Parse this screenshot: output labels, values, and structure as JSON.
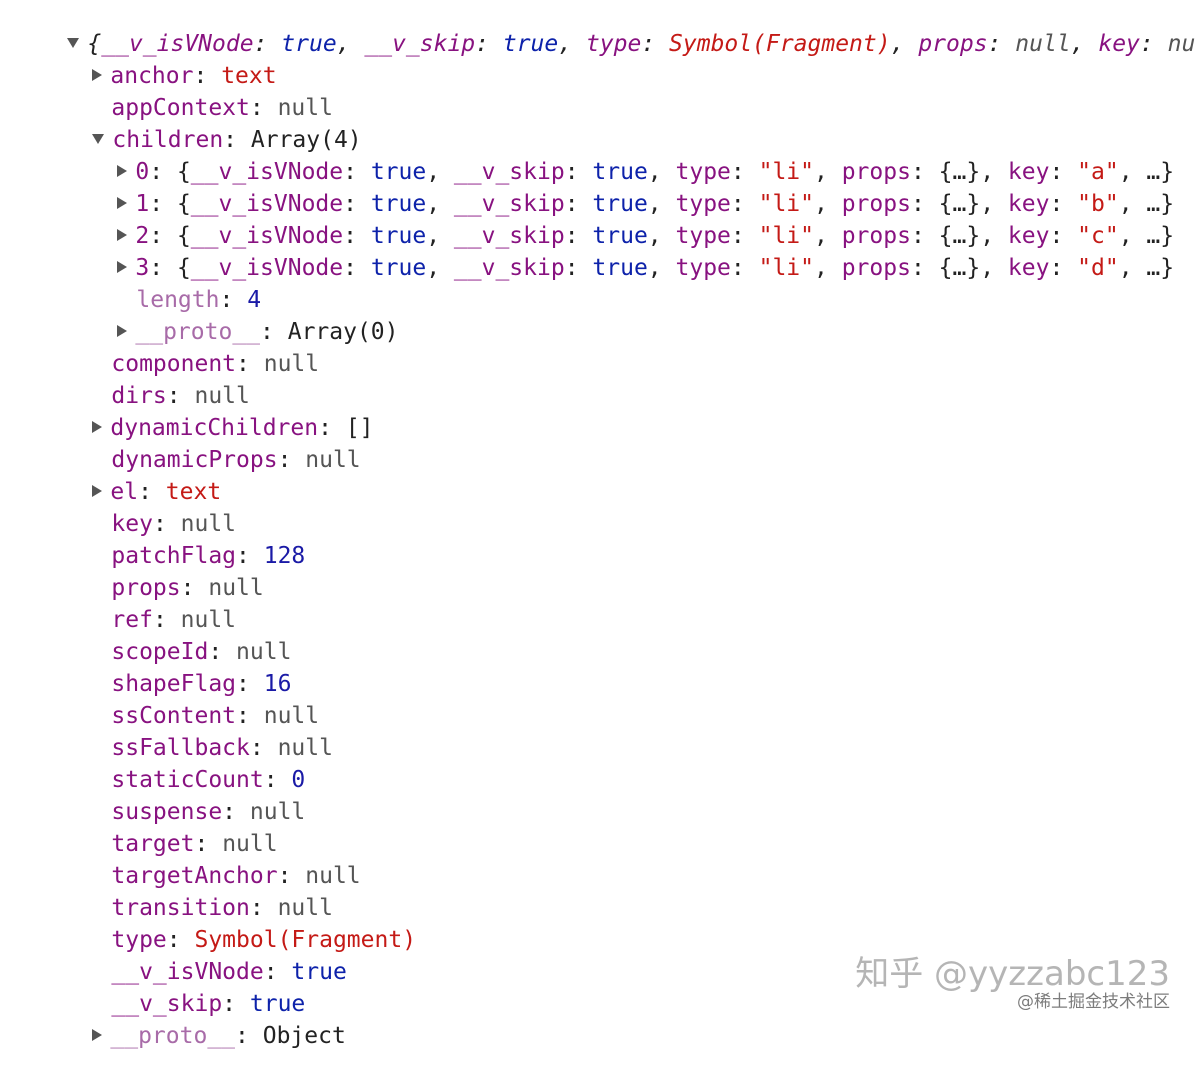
{
  "header": {
    "open": "{",
    "k1": "__v_isVNode",
    "v1": "true",
    "k2": "__v_skip",
    "v2": "true",
    "k3": "type",
    "v3": "Symbol(Fragment)",
    "k4": "props",
    "v4": "null",
    "k5": "key",
    "v5": "nul"
  },
  "props": {
    "anchor": {
      "key": "anchor",
      "value": "text"
    },
    "appContext": {
      "key": "appContext",
      "value": "null"
    },
    "children": {
      "key": "children",
      "value": "Array(4)"
    },
    "component": {
      "key": "component",
      "value": "null"
    },
    "dirs": {
      "key": "dirs",
      "value": "null"
    },
    "dynamicChildren": {
      "key": "dynamicChildren",
      "value": "[]"
    },
    "dynamicProps": {
      "key": "dynamicProps",
      "value": "null"
    },
    "el": {
      "key": "el",
      "value": "text"
    },
    "key": {
      "key": "key",
      "value": "null"
    },
    "patchFlag": {
      "key": "patchFlag",
      "value": "128"
    },
    "props": {
      "key": "props",
      "value": "null"
    },
    "ref": {
      "key": "ref",
      "value": "null"
    },
    "scopeId": {
      "key": "scopeId",
      "value": "null"
    },
    "shapeFlag": {
      "key": "shapeFlag",
      "value": "16"
    },
    "ssContent": {
      "key": "ssContent",
      "value": "null"
    },
    "ssFallback": {
      "key": "ssFallback",
      "value": "null"
    },
    "staticCount": {
      "key": "staticCount",
      "value": "0"
    },
    "suspense": {
      "key": "suspense",
      "value": "null"
    },
    "target": {
      "key": "target",
      "value": "null"
    },
    "targetAnchor": {
      "key": "targetAnchor",
      "value": "null"
    },
    "transition": {
      "key": "transition",
      "value": "null"
    },
    "type": {
      "key": "type",
      "value": "Symbol(Fragment)"
    },
    "isVNode": {
      "key": "__v_isVNode",
      "value": "true"
    },
    "skip": {
      "key": "__v_skip",
      "value": "true"
    },
    "proto": {
      "key": "__proto__",
      "value": "Object"
    }
  },
  "children_items": [
    {
      "index": "0",
      "key_val": "\"a\""
    },
    {
      "index": "1",
      "key_val": "\"b\""
    },
    {
      "index": "2",
      "key_val": "\"c\""
    },
    {
      "index": "3",
      "key_val": "\"d\""
    }
  ],
  "child_common": {
    "k1": "__v_isVNode",
    "v1": "true",
    "k2": "__v_skip",
    "v2": "true",
    "k3": "type",
    "v3": "\"li\"",
    "k4": "props",
    "v4": "{…}",
    "k5": "key",
    "ellipsis": "…"
  },
  "children_meta": {
    "length_key": "length",
    "length_value": "4",
    "proto_key": "__proto__",
    "proto_value": "Array(0)"
  },
  "watermark": {
    "main": "知乎 @yyzzabc123",
    "sub": "@稀土掘金技术社区"
  },
  "colors": {
    "property_key": "#881280",
    "number_or_boolean": "#1a1aa6",
    "string": "#c41a16",
    "null": "#555555"
  }
}
